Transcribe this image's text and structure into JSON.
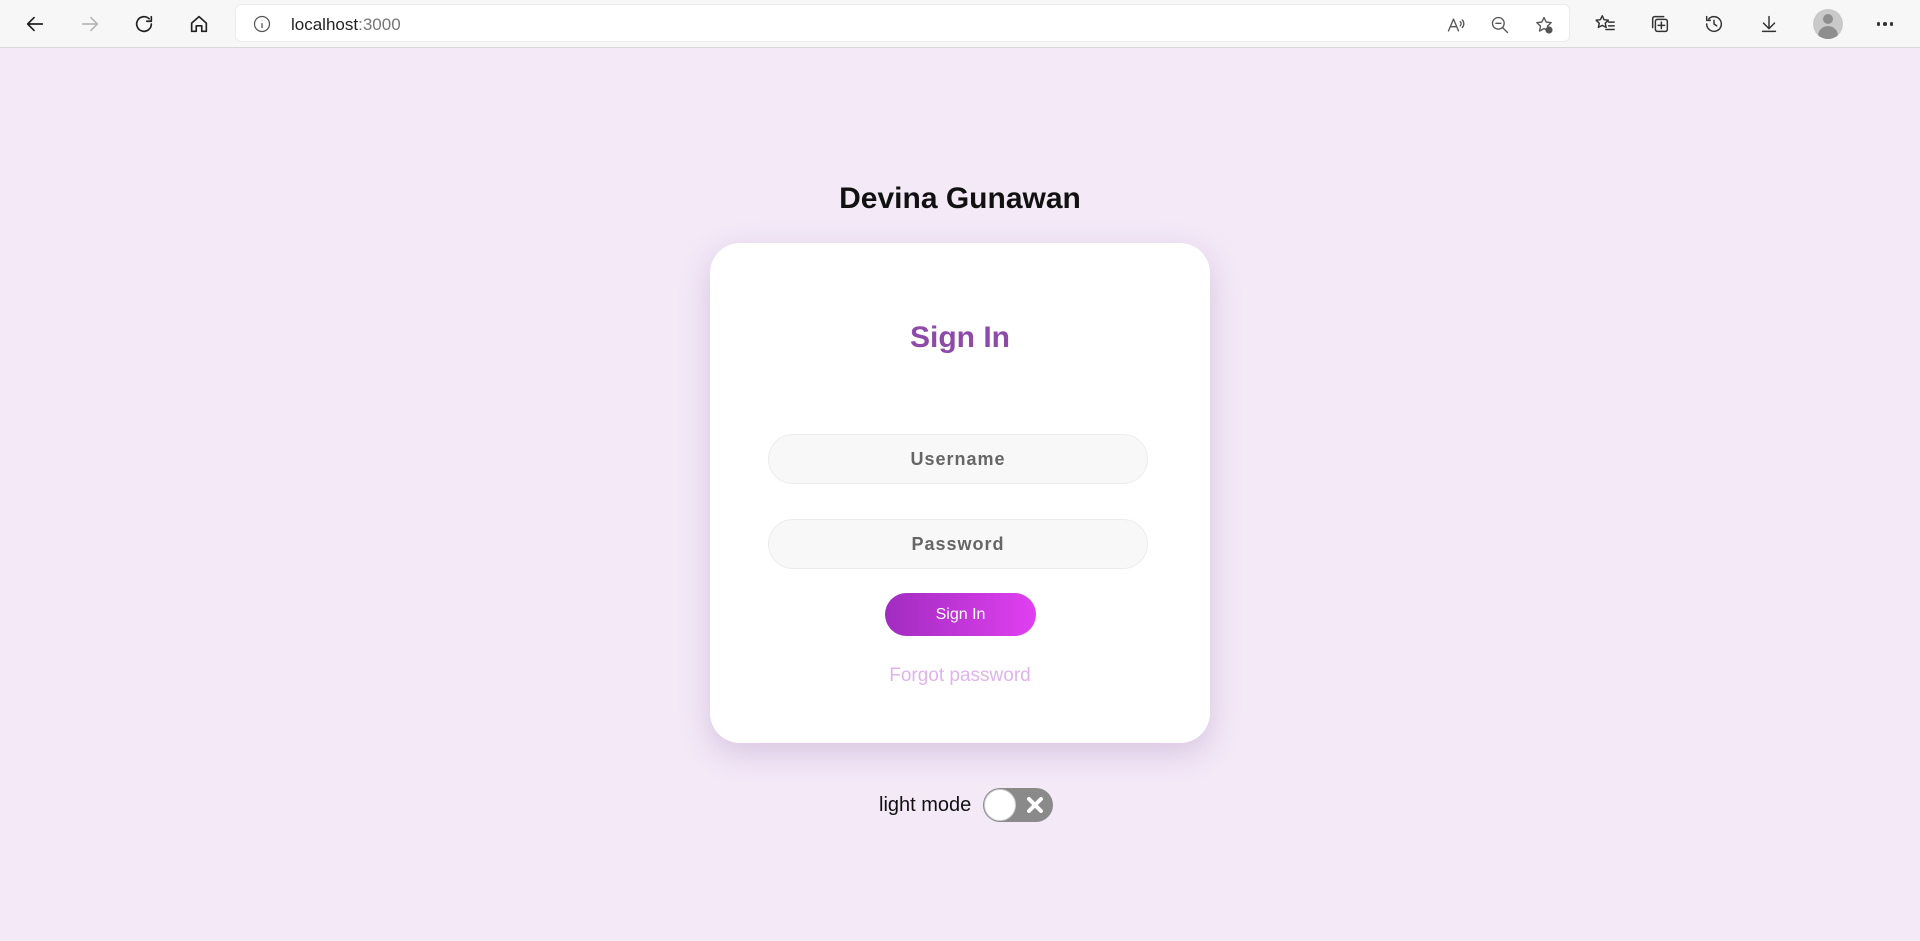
{
  "browser": {
    "url_host": "localhost",
    "url_port": ":3000"
  },
  "page": {
    "title": "Devina Gunawan"
  },
  "signin_card": {
    "heading": "Sign In",
    "username_placeholder": "Username",
    "password_placeholder": "Password",
    "submit_label": "Sign In",
    "forgot_password_label": "Forgot password"
  },
  "theme_toggle": {
    "label": "light mode",
    "enabled": false
  },
  "colors": {
    "page_background": "#f3e9f7",
    "heading_accent": "#8e4aa9",
    "button_gradient_start": "#a12cc0",
    "button_gradient_end": "#e040f0",
    "forgot_link": "#e0b3ec",
    "toggle_off": "#8a8a8a"
  }
}
